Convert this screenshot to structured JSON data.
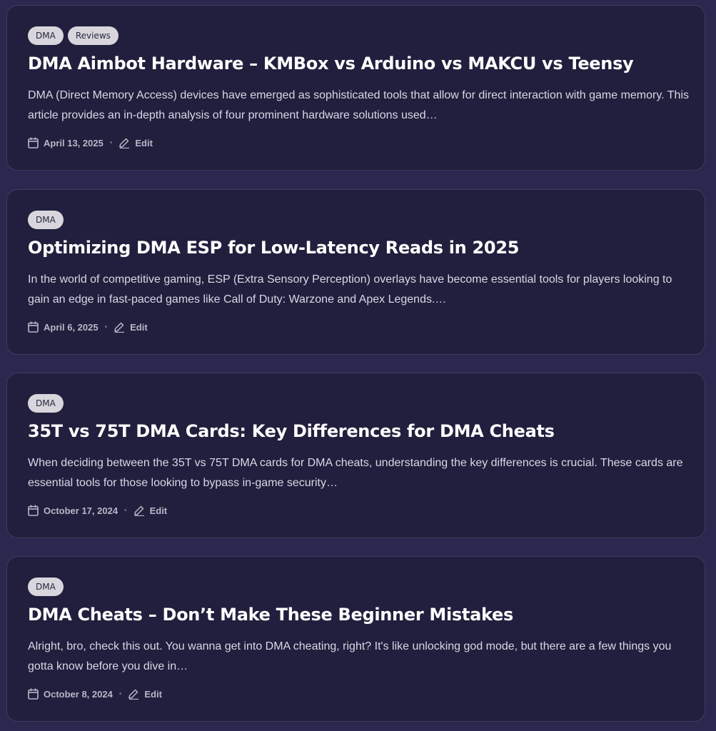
{
  "posts": [
    {
      "tags": [
        "DMA",
        "Reviews"
      ],
      "title": "DMA Aimbot Hardware – KMBox vs Arduino vs MAKCU vs Teensy",
      "excerpt": "DMA (Direct Memory Access) devices have emerged as sophisticated tools that allow for direct interaction with game memory. This article provides an in-depth analysis of four prominent hardware solutions used…",
      "date": "April 13, 2025",
      "edit_label": "Edit"
    },
    {
      "tags": [
        "DMA"
      ],
      "title": "Optimizing DMA ESP for Low-Latency Reads in 2025",
      "excerpt": "In the world of competitive gaming, ESP (Extra Sensory Perception) overlays have become essential tools for players looking to gain an edge in fast-paced games like Call of Duty: Warzone and Apex Legends.…",
      "date": "April 6, 2025",
      "edit_label": "Edit"
    },
    {
      "tags": [
        "DMA"
      ],
      "title": "35T vs 75T DMA Cards: Key Differences for DMA Cheats",
      "excerpt": "When deciding between the 35T vs 75T DMA cards for DMA cheats, understanding the key differences is crucial. These cards are essential tools for those looking to bypass in-game security…",
      "date": "October 17, 2024",
      "edit_label": "Edit"
    },
    {
      "tags": [
        "DMA"
      ],
      "title": "DMA Cheats – Don’t Make These Beginner Mistakes",
      "excerpt": "Alright, bro, check this out. You wanna get into DMA cheating, right? It's like unlocking god mode, but there are a few things you gotta know before you dive in…",
      "date": "October 8, 2024",
      "edit_label": "Edit"
    }
  ],
  "icons": {
    "date": "calendar-icon",
    "edit": "pencil-icon",
    "separator": "•"
  },
  "colors": {
    "page_background": "#2b2850",
    "card_background": "#211f3d",
    "tag_background": "#d8d6dc",
    "title": "#ffffff",
    "meta": "#b9b6c9"
  }
}
